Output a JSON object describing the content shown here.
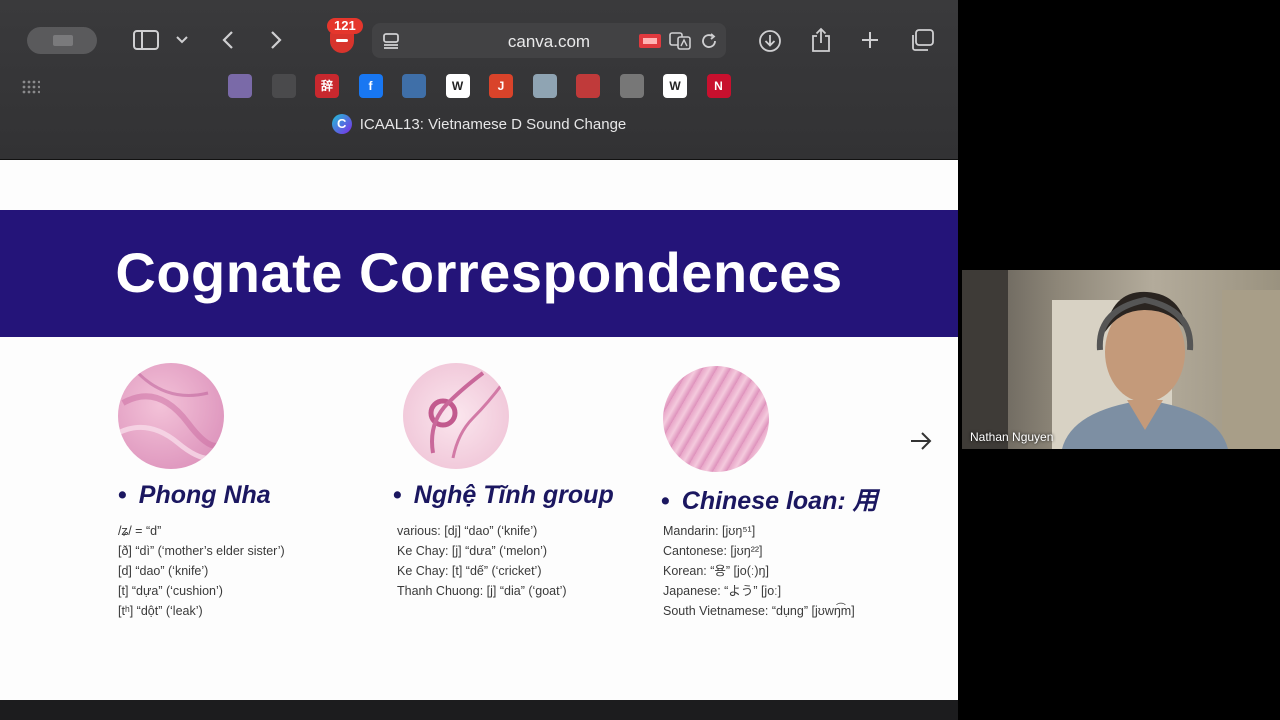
{
  "browser": {
    "address": "canva.com",
    "extension_badge_count": "121",
    "tab_title": "ICAAL13: Vietnamese D Sound Change",
    "tab_logo_letter": "C",
    "bookmarks": [
      {
        "icon": "chart-bookmark-icon",
        "label": "",
        "color": "#7a6aa8"
      },
      {
        "icon": "dark-square-bookmark-icon",
        "label": "",
        "color": "#4a4a4c"
      },
      {
        "icon": "red-chinese-bookmark-icon",
        "label": "辞",
        "color": "#c8282e"
      },
      {
        "icon": "facebook-icon",
        "label": "f",
        "color": "#1877f2"
      },
      {
        "icon": "globe-blue-bookmark-icon",
        "label": "",
        "color": "#3f6fa8"
      },
      {
        "icon": "wikipedia-icon",
        "label": "W",
        "color": "#ffffff"
      },
      {
        "icon": "red-j-bookmark-icon",
        "label": "J",
        "color": "#d9432a"
      },
      {
        "icon": "compass-bookmark-icon",
        "label": "",
        "color": "#8fa4b3"
      },
      {
        "icon": "red-grid-bookmark-icon",
        "label": "",
        "color": "#c03a3a"
      },
      {
        "icon": "globe-grey-bookmark-icon",
        "label": "",
        "color": "#777777"
      },
      {
        "icon": "wiktionary-icon",
        "label": "W",
        "color": "#ffffff"
      },
      {
        "icon": "n-bookmark-icon",
        "label": "N",
        "color": "#c8102e"
      }
    ]
  },
  "slide": {
    "title": "Cognate Correspondences",
    "colors": {
      "band": "#241479",
      "heading": "#1b1760"
    },
    "columns": [
      {
        "heading": "Phong Nha",
        "lines": [
          "/ʑ/ = “d”",
          "[ð] “dì” (‘mother’s elder sister’)",
          "[d] “dao” (‘knife’)",
          "[t] “dựa” (‘cushion’)",
          "[tʰ] “dột” (‘leak’)"
        ]
      },
      {
        "heading": "Nghệ Tĩnh group",
        "lines": [
          "various: [dj] “dao” (‘knife’)",
          "Ke Chay: [j] “dưa” (‘melon’)",
          "Ke Chay: [t] “dế” (‘cricket’)",
          "Thanh Chuong: [j] “dia” (‘goat’)"
        ]
      },
      {
        "heading": "Chinese loan: 用",
        "lines": [
          "Mandarin: [jʊŋ⁵¹]",
          "Cantonese: [jʊŋ²²]",
          "Korean: “용” [jo(ː)ŋ]",
          "Japanese: “よう” [joː]",
          "South Vietnamese: “dụng” [jʊwŋ͡m]"
        ]
      }
    ]
  },
  "video": {
    "participant_name": "Nathan Nguyen"
  }
}
